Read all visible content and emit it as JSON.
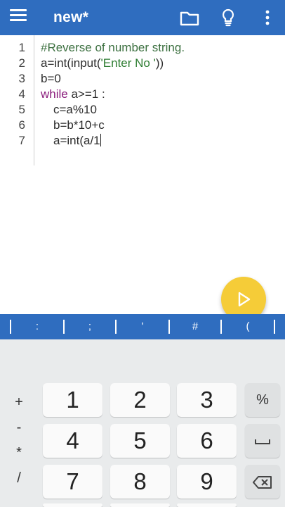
{
  "appbar": {
    "title": "new*",
    "icons": [
      "menu-icon",
      "folder-icon",
      "lightbulb-icon",
      "more-vert-icon"
    ]
  },
  "editor": {
    "line_numbers": [
      "1",
      "2",
      "3",
      "4",
      "5",
      "6",
      "7"
    ],
    "lines": {
      "l1": "#Reverse of number string.",
      "l2a": "a=int(input(",
      "l2b": "'Enter No '",
      "l2c": "))",
      "l3": "b=0",
      "l4a": "while",
      "l4b": " a>=1 :",
      "l5": "c=a%10",
      "l6": "b=b*10+c",
      "l7a": "a=int(",
      "l7b": "a/1"
    }
  },
  "fab": {
    "icon": "play-icon"
  },
  "symbols": [
    ":",
    ";",
    "'",
    "#",
    "("
  ],
  "keypad": {
    "row1": [
      "1",
      "2",
      "3"
    ],
    "row2": [
      "4",
      "5",
      "6"
    ],
    "row3": [
      "7",
      "8",
      "9"
    ],
    "row4_partial": [
      "",
      "",
      ""
    ],
    "side": {
      "percent": "%"
    },
    "ops": [
      "+",
      "-",
      "*",
      "/"
    ]
  },
  "colors": {
    "primary": "#2f6dbf",
    "fab": "#f5cc38",
    "keypad_bg": "#e9ebec"
  }
}
